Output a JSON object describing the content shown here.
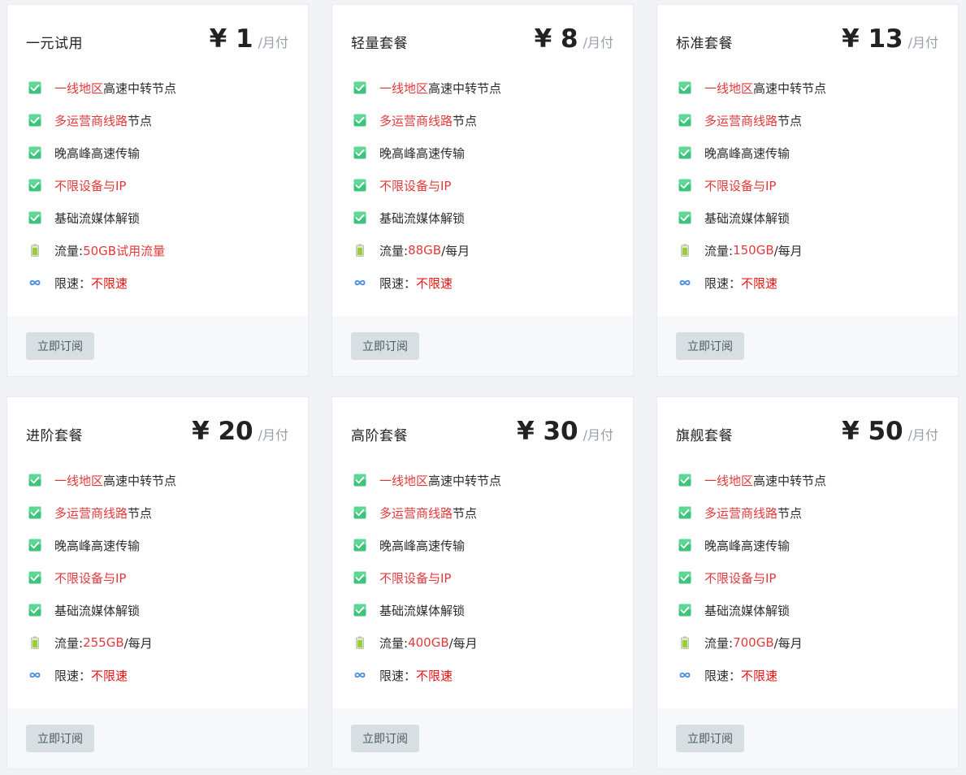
{
  "plans": [
    {
      "name": "一元试用",
      "price": "¥ 1",
      "per": "/月付",
      "traffic_label": "流量:",
      "traffic_value": "50GB试用流量",
      "traffic_suffix": ""
    },
    {
      "name": "轻量套餐",
      "price": "¥ 8",
      "per": "/月付",
      "traffic_label": "流量:",
      "traffic_value": "88GB",
      "traffic_suffix": " /每月"
    },
    {
      "name": "标准套餐",
      "price": "¥ 13",
      "per": "/月付",
      "traffic_label": "流量:",
      "traffic_value": "150GB",
      "traffic_suffix": " /每月"
    },
    {
      "name": "进阶套餐",
      "price": "¥ 20",
      "per": "/月付",
      "traffic_label": "流量:",
      "traffic_value": "255GB",
      "traffic_suffix": " /每月"
    },
    {
      "name": "高阶套餐",
      "price": "¥ 30",
      "per": "/月付",
      "traffic_label": "流量:",
      "traffic_value": "400GB",
      "traffic_suffix": " /每月"
    },
    {
      "name": "旗舰套餐",
      "price": "¥ 50",
      "per": "/月付",
      "traffic_label": "流量:",
      "traffic_value": "700GB",
      "traffic_suffix": " /每月"
    }
  ],
  "features": {
    "f1_red": "一线地区",
    "f1_rest": "高速中转节点",
    "f2_red": "多运营商线路",
    "f2_rest": "节点",
    "f3": "晚高峰高速传输",
    "f4": "不限设备与IP",
    "f5": "基础流媒体解锁",
    "speed_label": "限速：",
    "speed_value": "不限速"
  },
  "subscribe_label": "立即订阅",
  "icons": {
    "check": "check-box-icon",
    "battery": "battery-icon",
    "infinity": "infinity-icon"
  },
  "colors": {
    "accent_red": "#e2393b",
    "check_green": "#3cc47c",
    "button_bg": "#d7dfe3"
  }
}
